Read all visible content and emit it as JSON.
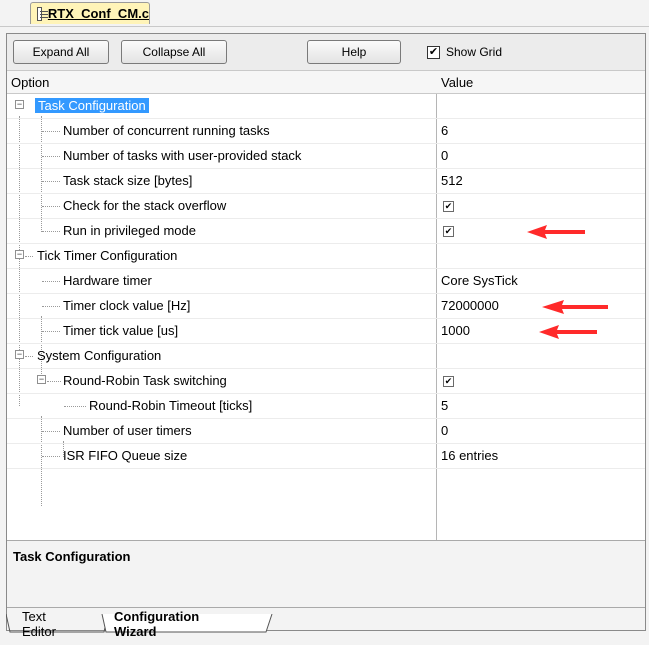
{
  "file_tab": {
    "label": "RTX_Conf_CM.c",
    "icon": "document-icon"
  },
  "toolbar": {
    "expand_all": "Expand All",
    "collapse_all": "Collapse All",
    "help": "Help",
    "show_grid": "Show Grid",
    "show_grid_checked": "✔"
  },
  "grid": {
    "header_option": "Option",
    "header_value": "Value",
    "rows": [
      {
        "option": "Task Configuration",
        "value": ""
      },
      {
        "option": "Number of concurrent running tasks",
        "value": "6"
      },
      {
        "option": "Number of tasks with user-provided stack",
        "value": "0"
      },
      {
        "option": "Task stack size [bytes]",
        "value": "512"
      },
      {
        "option": "Check for the stack overflow",
        "value": "✔"
      },
      {
        "option": "Run in privileged mode",
        "value": "✔"
      },
      {
        "option": "Tick Timer Configuration",
        "value": ""
      },
      {
        "option": "Hardware timer",
        "value": "Core SysTick"
      },
      {
        "option": "Timer clock value [Hz]",
        "value": "72000000"
      },
      {
        "option": "Timer tick value [us]",
        "value": "1000"
      },
      {
        "option": "System Configuration",
        "value": ""
      },
      {
        "option": "Round-Robin Task switching",
        "value": "✔"
      },
      {
        "option": "Round-Robin Timeout [ticks]",
        "value": "5"
      },
      {
        "option": "Number of user timers",
        "value": "0"
      },
      {
        "option": "ISR FIFO Queue size",
        "value": "16 entries"
      }
    ]
  },
  "description": {
    "title": "Task Configuration"
  },
  "bottom_tabs": {
    "text_editor": "Text Editor",
    "configuration_wizard": "Configuration Wizard"
  },
  "colors": {
    "selection": "#3399ff",
    "arrow": "#ff2a2a",
    "file_tab_bg": "#fff4b8"
  }
}
